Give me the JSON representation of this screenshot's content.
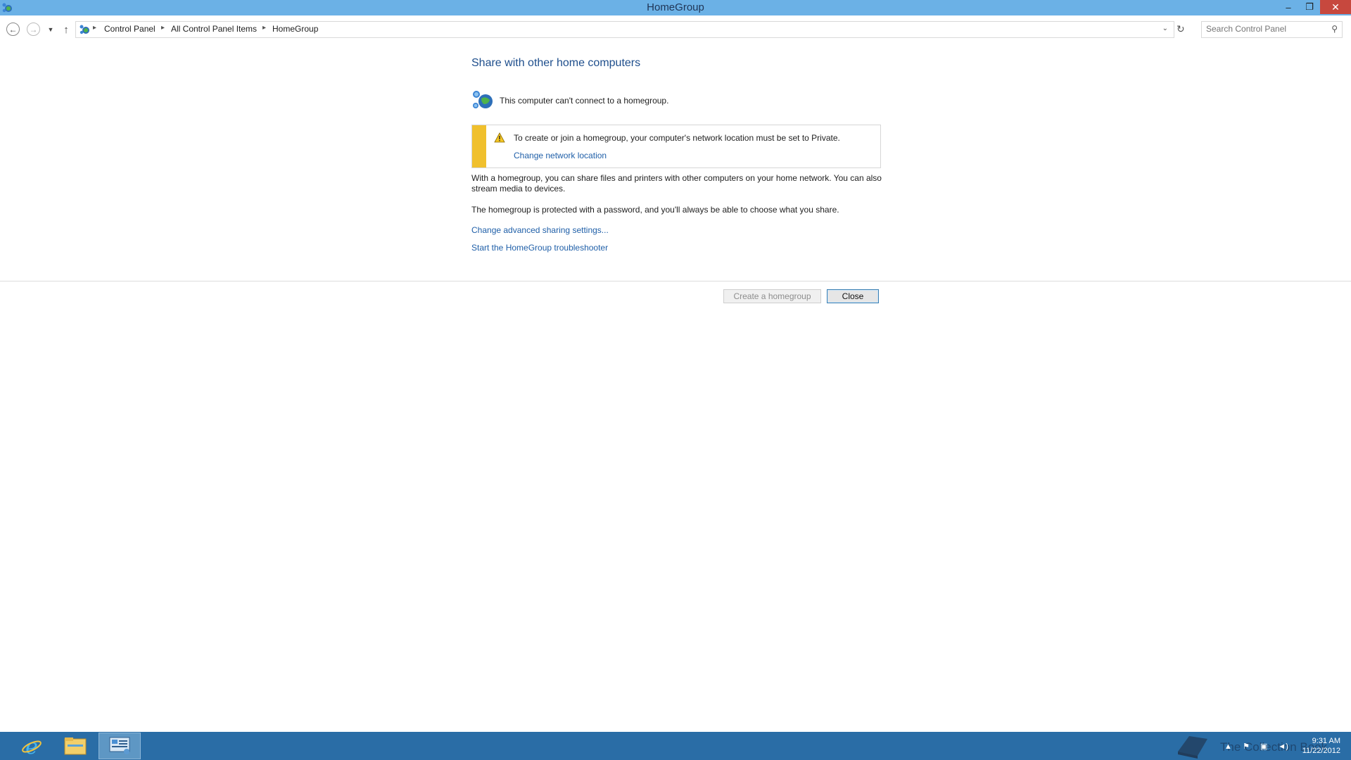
{
  "window": {
    "title": "HomeGroup",
    "minimize_glyph": "–",
    "maximize_glyph": "❐",
    "close_glyph": "✕"
  },
  "nav": {
    "back_glyph": "←",
    "forward_glyph": "→",
    "recent_glyph": "▼",
    "up_glyph": "↑",
    "breadcrumb": [
      "Control Panel",
      "All Control Panel Items",
      "HomeGroup"
    ],
    "separator_glyph": "▸",
    "dropdown_glyph": "⌄",
    "refresh_glyph": "↻",
    "search_placeholder": "Search Control Panel",
    "search_glyph": "⚲"
  },
  "main": {
    "heading": "Share with other home computers",
    "status": "This computer can't connect to a homegroup.",
    "warning": {
      "text": "To create or join a homegroup, your computer's network location must be set to Private.",
      "link": "Change network location",
      "bar_color": "#f0c02d"
    },
    "para1": "With a homegroup, you can share files and printers with other computers on your home network. You can also stream media to devices.",
    "para2": "The homegroup is protected with a password, and you'll always be able to choose what you share.",
    "link_advanced": "Change advanced sharing settings...",
    "link_troubleshooter": "Start the HomeGroup troubleshooter",
    "buttons": {
      "create": "Create a homegroup",
      "close": "Close"
    }
  },
  "taskbar": {
    "apps": [
      "internet-explorer-icon",
      "file-explorer-icon",
      "control-panel-icon"
    ],
    "watermark": "The Collection Book",
    "tray": [
      "▲",
      "⚑",
      "▣",
      "◄)"
    ],
    "time": "9:31 AM",
    "date": "11/22/2012",
    "color": "#2a6da6"
  }
}
